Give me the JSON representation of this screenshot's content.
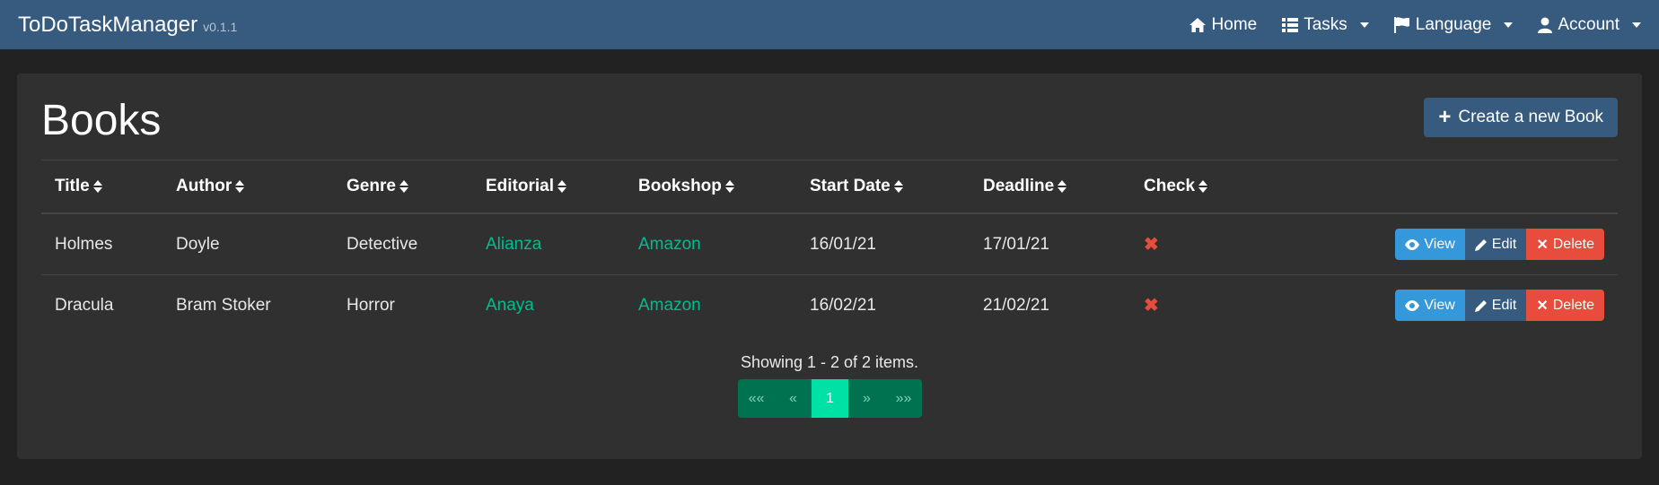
{
  "navbar": {
    "brand": "ToDoTaskManager",
    "version": "v0.1.1",
    "items": [
      {
        "label": "Home",
        "icon": "home-icon",
        "dropdown": false
      },
      {
        "label": "Tasks",
        "icon": "list-icon",
        "dropdown": true
      },
      {
        "label": "Language",
        "icon": "flag-icon",
        "dropdown": true
      },
      {
        "label": "Account",
        "icon": "user-icon",
        "dropdown": true
      }
    ]
  },
  "page": {
    "title": "Books",
    "create_button": "Create a new Book"
  },
  "table": {
    "columns": [
      "Title",
      "Author",
      "Genre",
      "Editorial",
      "Bookshop",
      "Start Date",
      "Deadline",
      "Check"
    ],
    "rows": [
      {
        "title": "Holmes",
        "author": "Doyle",
        "genre": "Detective",
        "editorial": "Alianza",
        "bookshop": "Amazon",
        "start_date": "16/01/21",
        "deadline": "17/01/21",
        "check": "✖"
      },
      {
        "title": "Dracula",
        "author": "Bram Stoker",
        "genre": "Horror",
        "editorial": "Anaya",
        "bookshop": "Amazon",
        "start_date": "16/02/21",
        "deadline": "21/02/21",
        "check": "✖"
      }
    ],
    "row_actions": {
      "view": "View",
      "edit": "Edit",
      "delete": "Delete"
    }
  },
  "pagination": {
    "summary": "Showing 1 - 2 of 2 items.",
    "first": "««",
    "prev": "«",
    "current": "1",
    "next": "»",
    "last": "»»"
  },
  "colors": {
    "navbar": "#375a7f",
    "background": "#222222",
    "card": "#303030",
    "link": "#00bc8c",
    "view": "#3498db",
    "delete": "#e74c3c"
  }
}
